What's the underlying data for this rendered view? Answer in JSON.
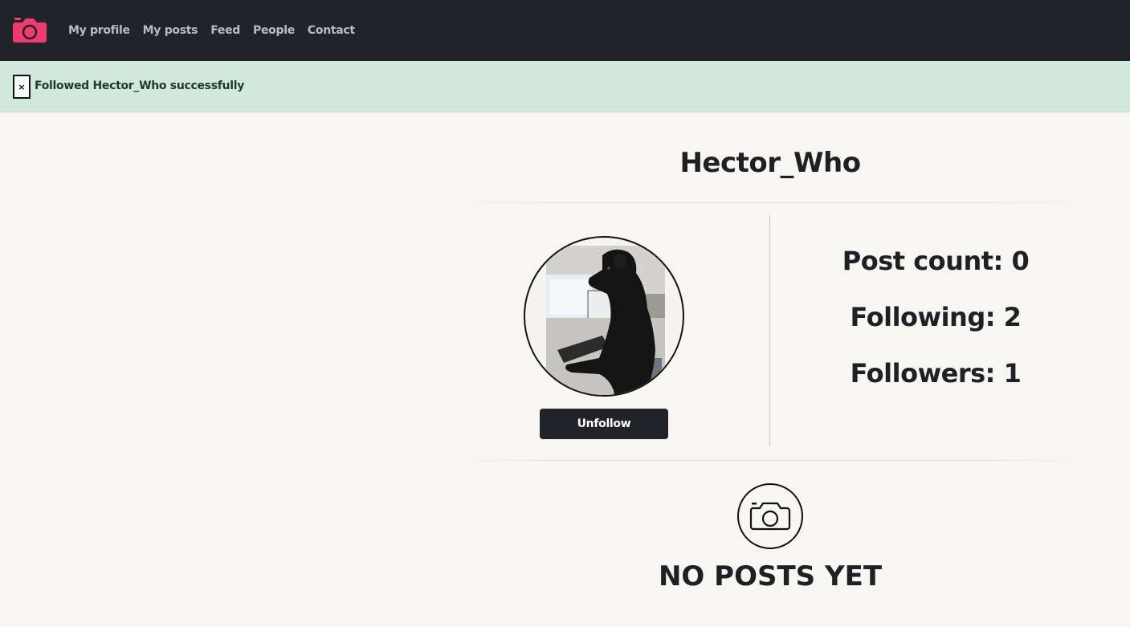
{
  "navbar": {
    "brand_icon": "camera-icon",
    "brand_color": "#ef3b6f",
    "links": [
      {
        "label": "My profile"
      },
      {
        "label": "My posts"
      },
      {
        "label": "Feed"
      },
      {
        "label": "People"
      },
      {
        "label": "Contact"
      }
    ]
  },
  "alert": {
    "close_label": "×",
    "message": "Followed Hector_Who successfully",
    "color": "#d2e8df"
  },
  "profile": {
    "username": "Hector_Who",
    "avatar_icon": "dog-photo",
    "unfollow_label": "Unfollow",
    "stats": {
      "post_count": "Post count: 0",
      "following": "Following: 2",
      "followers": "Followers: 1"
    }
  },
  "posts": {
    "empty_icon": "camera-icon",
    "empty_text": "NO POSTS YET"
  }
}
